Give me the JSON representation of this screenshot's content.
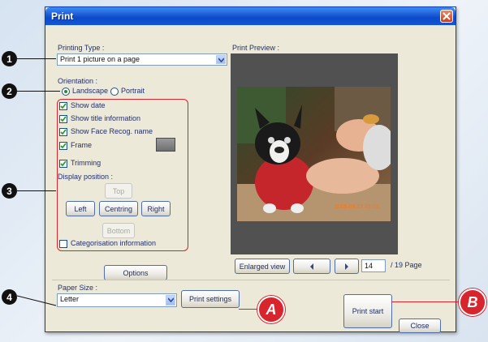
{
  "window": {
    "title": "Print"
  },
  "printing_type": {
    "label": "Printing Type :",
    "value": "Print 1 picture on a page"
  },
  "orientation": {
    "label": "Orientation :",
    "landscape": "Landscape",
    "portrait": "Portrait",
    "selected": "Landscape"
  },
  "options": {
    "show_date": {
      "label": "Show date",
      "checked": true
    },
    "show_title": {
      "label": "Show title information",
      "checked": true
    },
    "show_face": {
      "label": "Show Face Recog. name",
      "checked": true
    },
    "frame": {
      "label": "Frame",
      "checked": true
    },
    "trimming": {
      "label": "Trimming",
      "checked": true
    },
    "categorisation": {
      "label": "Categorisation information",
      "checked": false
    }
  },
  "display_position": {
    "label": "Display position :",
    "top": "Top",
    "left": "Left",
    "centring": "Centring",
    "right": "Right",
    "bottom": "Bottom"
  },
  "buttons": {
    "options": "Options",
    "print_settings": "Print settings",
    "print_start": "Print start",
    "close": "Close",
    "enlarged_view": "Enlarged view"
  },
  "preview": {
    "label": "Print Preview :",
    "page_current": "14",
    "page_total": "/ 19 Page"
  },
  "paper_size": {
    "label": "Paper Size :",
    "value": "Letter"
  },
  "callouts": {
    "c1": "1",
    "c2": "2",
    "c3": "3",
    "c4": "4",
    "a": "A",
    "b": "B"
  },
  "colors": {
    "accent_red": "#d8242d",
    "titlebar": "#0a49c9",
    "dialog_bg": "#ece9d8"
  }
}
